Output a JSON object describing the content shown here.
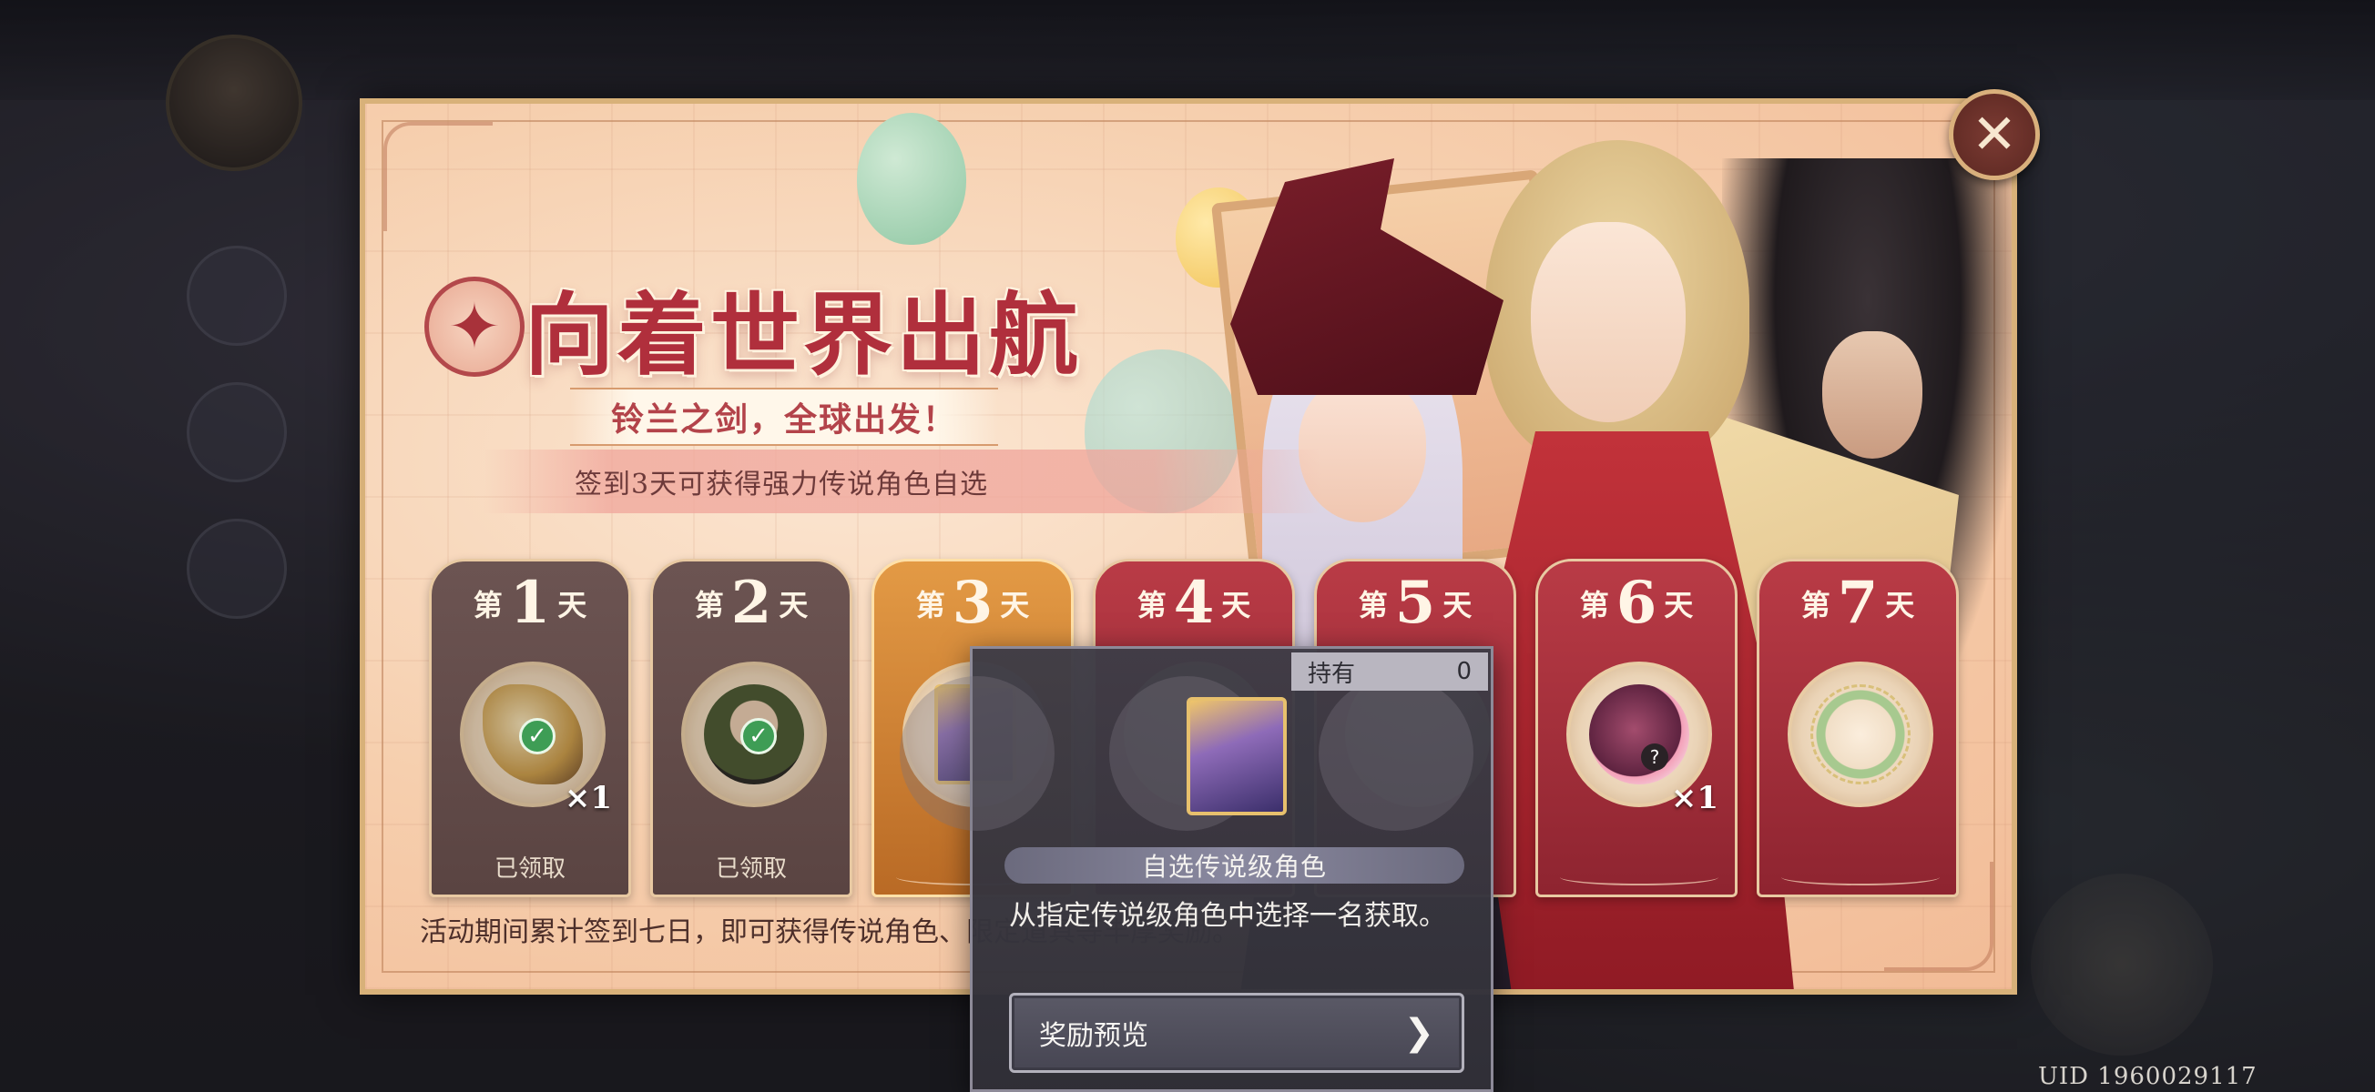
{
  "event": {
    "title": "向着世界出航",
    "subtitle": "铃兰之剑，全球出发！",
    "checkin_hint": "签到3天可获得强力传说角色自选",
    "footer_description": "活动期间累计签到七日，即可获得传说角色、限定道具等丰厚奖励。"
  },
  "days": [
    {
      "prefix": "第",
      "number": "1",
      "suffix": "天",
      "state": "claimed",
      "item_icon": "bouquet-icon",
      "quantity": "×1",
      "status": "已领取"
    },
    {
      "prefix": "第",
      "number": "2",
      "suffix": "天",
      "state": "claimed",
      "item_icon": "character-avatar-icon",
      "quantity": "",
      "status": "已领取"
    },
    {
      "prefix": "第",
      "number": "3",
      "suffix": "天",
      "state": "current",
      "item_icon": "legend-frame-icon",
      "quantity": "",
      "status": ""
    },
    {
      "prefix": "第",
      "number": "4",
      "suffix": "天",
      "state": "future",
      "item_icon": "",
      "quantity": "",
      "status": ""
    },
    {
      "prefix": "第",
      "number": "5",
      "suffix": "天",
      "state": "future",
      "item_icon": "",
      "quantity": "",
      "status": ""
    },
    {
      "prefix": "第",
      "number": "6",
      "suffix": "天",
      "state": "future",
      "item_icon": "pot-icon",
      "quantity": "×1",
      "status": ""
    },
    {
      "prefix": "第",
      "number": "7",
      "suffix": "天",
      "state": "future",
      "item_icon": "wreath-icon",
      "quantity": "",
      "status": ""
    }
  ],
  "tooltip": {
    "owned_label": "持有",
    "owned_count": "0",
    "item_name": "自选传说级角色",
    "description": "从指定传说级角色中选择一名获取。",
    "preview_button": "奖励预览",
    "item_icon": "legend-frame-icon"
  },
  "close_icon": "close-icon",
  "uid_text": "UID 1960029117",
  "colors": {
    "title_red": "#b02f3c",
    "frame_gold": "#d8b179",
    "claimed_card": "#6c5452",
    "current_card": "#e39a45",
    "future_card": "#b93b46"
  }
}
